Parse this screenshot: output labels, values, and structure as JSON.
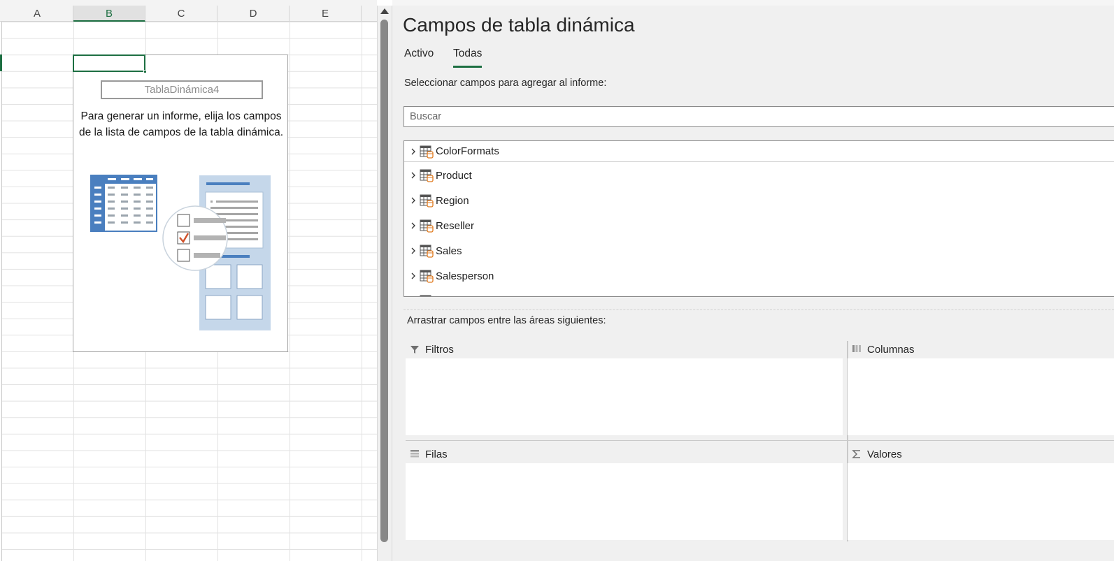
{
  "sheet": {
    "columns": [
      "A",
      "B",
      "C",
      "D",
      "E"
    ],
    "selected_column": "B",
    "pivot_placeholder": {
      "name": "TablaDinámica4",
      "hint": "Para generar un informe, elija los campos de la lista de campos de la tabla dinámica."
    }
  },
  "pane": {
    "title": "Campos de tabla dinámica",
    "tabs": [
      {
        "label": "Activo",
        "active": false
      },
      {
        "label": "Todas",
        "active": true
      }
    ],
    "select_label": "Seleccionar campos para agregar al informe:",
    "search": {
      "placeholder": "Buscar",
      "value": ""
    },
    "fields": [
      {
        "label": "ColorFormats",
        "icon": "table-icon"
      },
      {
        "label": "Product",
        "icon": "table-icon"
      },
      {
        "label": "Region",
        "icon": "table-icon"
      },
      {
        "label": "Reseller",
        "icon": "table-icon"
      },
      {
        "label": "Sales",
        "icon": "table-icon"
      },
      {
        "label": "Salesperson",
        "icon": "table-icon"
      }
    ],
    "drag_label": "Arrastrar campos entre las áreas siguientes:",
    "areas": {
      "filters": {
        "label": "Filtros",
        "icon": "filter-icon"
      },
      "columns": {
        "label": "Columnas",
        "icon": "columns-icon"
      },
      "rows": {
        "label": "Filas",
        "icon": "rows-icon"
      },
      "values": {
        "label": "Valores",
        "icon": "sigma-icon"
      }
    }
  },
  "colors": {
    "accent": "#1d6f42",
    "pane_bg": "#f0f0f0",
    "illustration_blue": "#4a7fbf",
    "check_orange": "#d0512a"
  }
}
